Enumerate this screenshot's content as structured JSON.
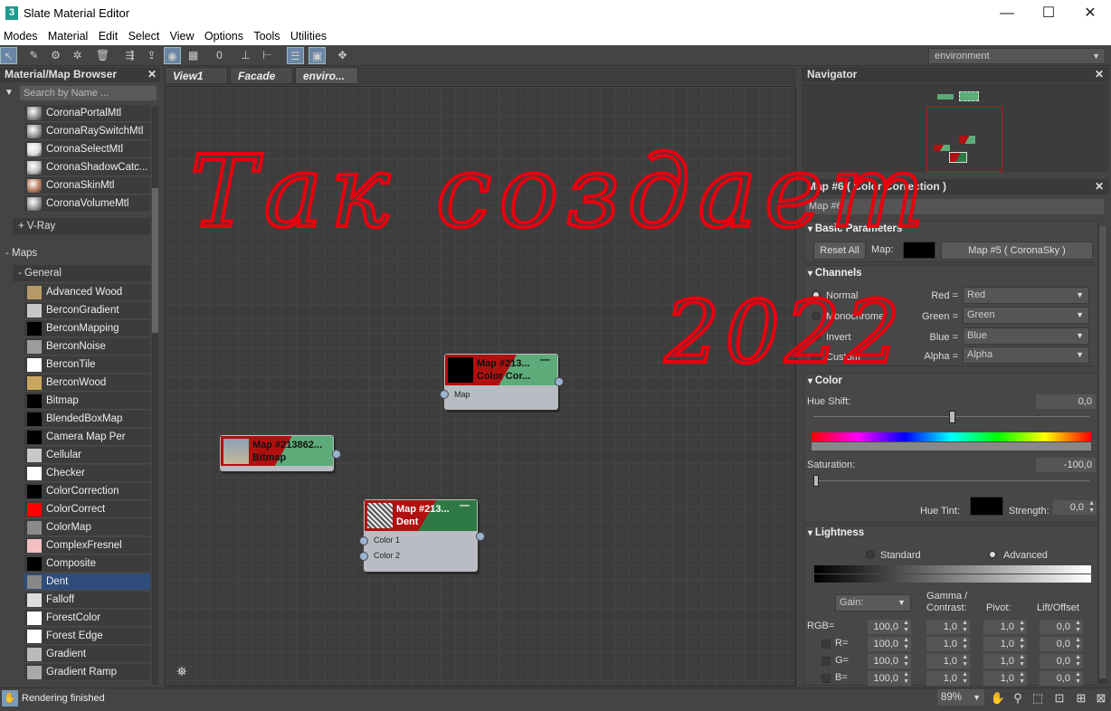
{
  "app": {
    "title": "Slate Material Editor",
    "icon_glyph": "3",
    "window_buttons": [
      "—",
      "☐",
      "✕"
    ]
  },
  "menu": [
    "Modes",
    "Material",
    "Edit",
    "Select",
    "View",
    "Options",
    "Tools",
    "Utilities"
  ],
  "toolbar": {
    "environment_select": "environment",
    "icons": [
      "select-icon",
      "eyedropper-icon",
      "pick-material-icon",
      "put-to-library-icon",
      "delete-icon",
      "move-children-icon",
      "hide-unused-icon",
      "layout-all-icon",
      "show-map-icon",
      "background-icon",
      "zero-icon",
      "layout-icon",
      "layout-children-icon",
      "params-icon",
      "lock-icon",
      "material-id-icon"
    ]
  },
  "browser": {
    "title": "Material/Map Browser",
    "search_placeholder": "Search by Name ...",
    "corona_items": [
      {
        "label": "CoronaPortalMtl",
        "color": "#8f8f8f"
      },
      {
        "label": "CoronaRaySwitchMtl",
        "color": "#9a9a9a"
      },
      {
        "label": "CoronaSelectMtl",
        "color": "#dcdcdc"
      },
      {
        "label": "CoronaShadowCatc...",
        "color": "#bfbfbf"
      },
      {
        "label": "CoronaSkinMtl",
        "color": "#b97d5e"
      },
      {
        "label": "CoronaVolumeMtl",
        "color": "#9a9a9a"
      }
    ],
    "vray_group": "+ V-Ray",
    "maps_group": "- Maps",
    "general_group": "- General",
    "map_items": [
      {
        "label": "Advanced Wood",
        "color": "#b89a6a"
      },
      {
        "label": "BerconGradient",
        "color": "#c8c8c8"
      },
      {
        "label": "BerconMapping",
        "color": "#000000"
      },
      {
        "label": "BerconNoise",
        "color": "#9c9c9c"
      },
      {
        "label": "BerconTile",
        "color": "#ffffff"
      },
      {
        "label": "BerconWood",
        "color": "#c9a660"
      },
      {
        "label": "Bitmap",
        "color": "#000000"
      },
      {
        "label": "BlendedBoxMap",
        "color": "#000000"
      },
      {
        "label": "Camera Map Per Pixel",
        "color": "#000000"
      },
      {
        "label": "Cellular",
        "color": "#c8c8c8"
      },
      {
        "label": "Checker",
        "color": "#ffffff"
      },
      {
        "label": "ColorCorrection",
        "color": "#000000"
      },
      {
        "label": "ColorCorrect",
        "color": "#ff0000"
      },
      {
        "label": "ColorMap",
        "color": "#8a8a8a"
      },
      {
        "label": "ComplexFresnel",
        "color": "#f2c0c0"
      },
      {
        "label": "Composite",
        "color": "#000000"
      },
      {
        "label": "Dent",
        "color": "#888888"
      },
      {
        "label": "Falloff",
        "color": "#dddddd"
      },
      {
        "label": "ForestColor",
        "color": "#ffffff"
      },
      {
        "label": "Forest Edge",
        "color": "#ffffff"
      },
      {
        "label": "Gradient",
        "color": "#bbbbbb"
      },
      {
        "label": "Gradient Ramp",
        "color": "#aaaaaa"
      }
    ],
    "selected": "Dent"
  },
  "view_tabs": [
    "View1",
    "Facade",
    "enviro..."
  ],
  "nodes": {
    "color_correction": {
      "name": "Map #213...",
      "type": "Color Cor...",
      "ports": [
        "Map"
      ]
    },
    "bitmap": {
      "name": "Map #213862...",
      "type": "Bitmap",
      "ports": []
    },
    "dent": {
      "name": "Map #213...",
      "type": "Dent",
      "ports": [
        "Color 1",
        "Color 2"
      ]
    }
  },
  "annotation": {
    "line1": "Так создает",
    "line2": "2022",
    "color": "#e8000f"
  },
  "navigator": {
    "title": "Navigator"
  },
  "params": {
    "header": "Map #6  ( Color Correction )",
    "map_name": "Map #6",
    "basic": {
      "title": "Basic Parameters",
      "reset": "Reset All",
      "map_label": "Map:",
      "map_button": "Map #5  ( CoronaSky )"
    },
    "channels": {
      "title": "Channels",
      "modes": [
        "Normal",
        "Monochrome",
        "Invert",
        "Custom"
      ],
      "selected": "Normal",
      "rows": [
        {
          "label": "Red =",
          "value": "Red"
        },
        {
          "label": "Green =",
          "value": "Green"
        },
        {
          "label": "Blue =",
          "value": "Blue"
        },
        {
          "label": "Alpha =",
          "value": "Alpha"
        }
      ]
    },
    "color": {
      "title": "Color",
      "hue_shift_label": "Hue Shift:",
      "hue_shift": "0,0",
      "saturation_label": "Saturation:",
      "saturation": "-100,0",
      "hue_tint_label": "Hue Tint:",
      "strength_label": "Strength:",
      "strength": "0,0"
    },
    "lightness": {
      "title": "Lightness",
      "standard": "Standard",
      "advanced": "Advanced",
      "gain": "Gain:",
      "columns": [
        "Gamma /\nContrast:",
        "Pivot:",
        "Lift/Offset"
      ],
      "rows": [
        {
          "label": "RGB=",
          "gain": "100,0",
          "gamma": "1,0",
          "pivot": "1,0",
          "lift": "0,0"
        },
        {
          "label": "R=",
          "gain": "100,0",
          "gamma": "1,0",
          "pivot": "1,0",
          "lift": "0,0"
        },
        {
          "label": "G=",
          "gain": "100,0",
          "gamma": "1,0",
          "pivot": "1,0",
          "lift": "0,0"
        },
        {
          "label": "B=",
          "gain": "100,0",
          "gamma": "1,0",
          "pivot": "1,0",
          "lift": "0,0"
        }
      ]
    }
  },
  "status": {
    "text": "Rendering finished",
    "zoom": "89%"
  }
}
